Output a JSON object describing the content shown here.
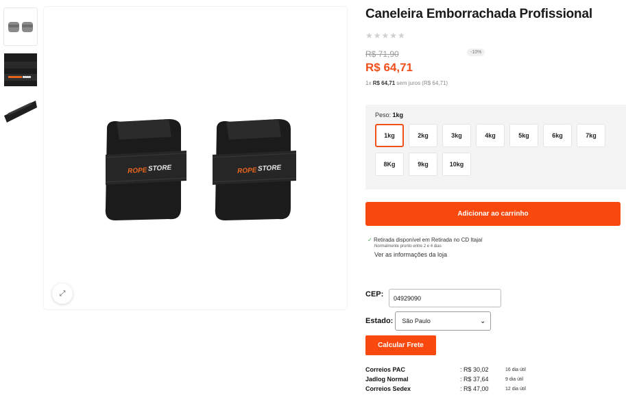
{
  "product": {
    "title": "Caneleira Emborrachada Profissional",
    "stars": "★★★★★",
    "old_price": "R$ 71,90",
    "discount": "-10%",
    "price": "R$ 64,71",
    "installments_prefix": "1x",
    "installments_value": "R$ 64,71",
    "installments_suffix": "sem juros (R$ 64,71)",
    "brand_on_product": "ROPE STORE"
  },
  "gallery": {
    "zoom_icon": "expand-icon"
  },
  "variant": {
    "label": "Peso:",
    "selected": "1kg",
    "options": [
      "1kg",
      "2kg",
      "3kg",
      "4kg",
      "5kg",
      "6kg",
      "7kg",
      "8Kg",
      "9kg",
      "10kg"
    ]
  },
  "cart": {
    "add_label": "Adicionar ao carrinho"
  },
  "pickup": {
    "availability": "Retirada disponível em Retirada no CD Itajaí",
    "ready_time": "Normalmente pronto entre 2 e 4 dias",
    "store_link": "Ver as informações da loja"
  },
  "freight": {
    "cep_label": "CEP:",
    "cep_value": "04929090",
    "state_label": "Estado:",
    "state_value": "São Paulo",
    "calc_label": "Calcular Frete",
    "options": [
      {
        "name": "Correios PAC",
        "price": ": R$ 30,02",
        "days": "16 dia útil"
      },
      {
        "name": "Jadlog Normal",
        "price": ": R$ 37,64",
        "days": "9 dia útil"
      },
      {
        "name": "Correios Sedex",
        "price": ": R$ 47,00",
        "days": "12 dia útil"
      }
    ]
  },
  "colors": {
    "accent": "#f9490f",
    "price": "#f04e1a"
  }
}
